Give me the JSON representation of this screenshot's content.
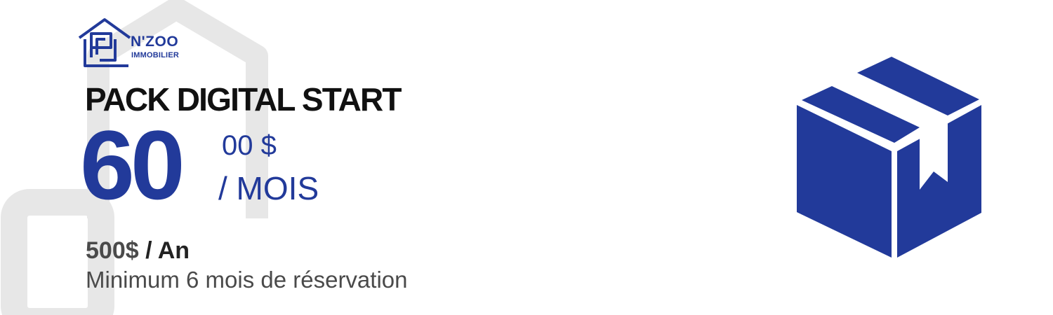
{
  "brand": {
    "name": "N'ZOO",
    "subtitle": "IMMOBILIER",
    "color": "#223a9a"
  },
  "pack": {
    "title": "PACK DIGITAL START",
    "price_main": "60",
    "price_cents": "00 $",
    "price_period": "/ MOIS",
    "yearly_amount": "500$",
    "yearly_period": "/ An",
    "minimum_note": "Minimum 6 mois de réservation"
  },
  "icons": {
    "logo": "house-logo-icon",
    "box": "package-box-icon"
  },
  "colors": {
    "accent": "#223a9a",
    "background_shapes": "#e6e6e6",
    "title_text": "#111111",
    "body_text": "#4a4a4a"
  }
}
